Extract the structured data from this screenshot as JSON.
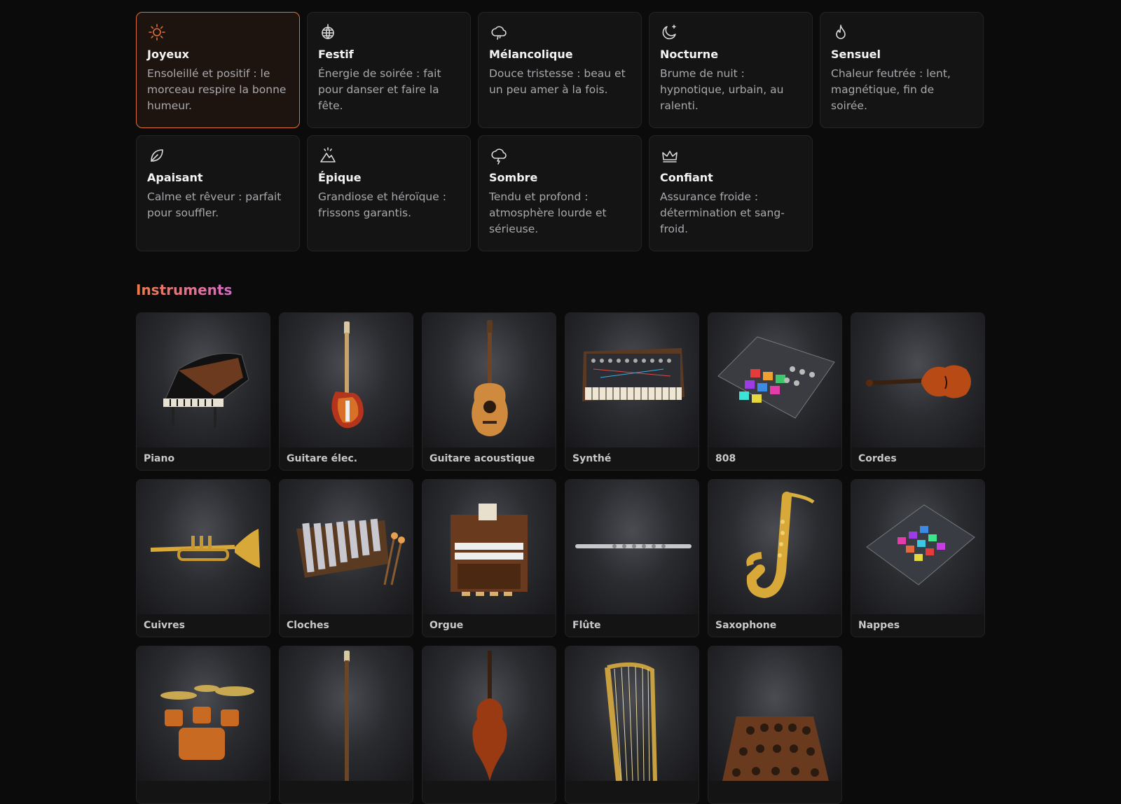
{
  "moods": [
    {
      "title": "Joyeux",
      "desc": "Ensoleillé et positif : le morceau respire la bonne humeur.",
      "icon": "sun-icon",
      "active": true
    },
    {
      "title": "Festif",
      "desc": "Énergie de soirée : fait pour danser et faire la fête.",
      "icon": "disco-ball-icon",
      "active": false
    },
    {
      "title": "Mélancolique",
      "desc": "Douce tristesse : beau et un peu amer à la fois.",
      "icon": "cloud-rain-icon",
      "active": false
    },
    {
      "title": "Nocturne",
      "desc": "Brume de nuit : hypnotique, urbain, au ralenti.",
      "icon": "moon-star-icon",
      "active": false
    },
    {
      "title": "Sensuel",
      "desc": "Chaleur feutrée : lent, magnétique, fin de soirée.",
      "icon": "flame-icon",
      "active": false
    },
    {
      "title": "Apaisant",
      "desc": "Calme et rêveur : parfait pour souffler.",
      "icon": "leaf-icon",
      "active": false
    },
    {
      "title": "Épique",
      "desc": "Grandiose et héroïque : frissons garantis.",
      "icon": "mountain-icon",
      "active": false
    },
    {
      "title": "Sombre",
      "desc": "Tendu et profond : atmosphère lourde et sérieuse.",
      "icon": "storm-cloud-icon",
      "active": false
    },
    {
      "title": "Confiant",
      "desc": "Assurance froide : détermination et sang-froid.",
      "icon": "crown-icon",
      "active": false
    }
  ],
  "instruments_title": "Instruments",
  "instruments": [
    {
      "label": "Piano",
      "art": "piano"
    },
    {
      "label": "Guitare élec.",
      "art": "electric-guitar"
    },
    {
      "label": "Guitare acoustique",
      "art": "acoustic-guitar"
    },
    {
      "label": "Synthé",
      "art": "synth"
    },
    {
      "label": "808",
      "art": "drum-machine"
    },
    {
      "label": "Cordes",
      "art": "violin"
    },
    {
      "label": "Cuivres",
      "art": "trumpet"
    },
    {
      "label": "Cloches",
      "art": "xylophone"
    },
    {
      "label": "Orgue",
      "art": "organ"
    },
    {
      "label": "Flûte",
      "art": "flute"
    },
    {
      "label": "Saxophone",
      "art": "saxophone"
    },
    {
      "label": "Nappes",
      "art": "pad"
    },
    {
      "label": "",
      "art": "drum-kit"
    },
    {
      "label": "",
      "art": "bass"
    },
    {
      "label": "",
      "art": "cello"
    },
    {
      "label": "",
      "art": "harp"
    },
    {
      "label": "",
      "art": "orchestra"
    }
  ],
  "colors": {
    "accent": "#e0703a",
    "title_gradient_start": "#ee7a46",
    "title_gradient_end": "#d56bc4"
  }
}
